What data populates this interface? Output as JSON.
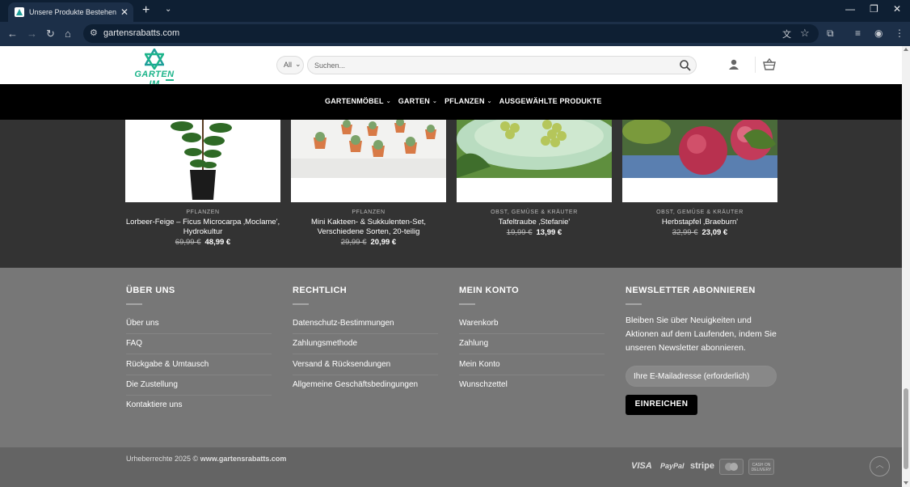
{
  "browser": {
    "tab_title": "Unsere Produkte Bestehen Aus",
    "tab_close": "✕",
    "new_tab": "+",
    "url": "gartensrabatts.com"
  },
  "header": {
    "logo_text": "GARTEN IM",
    "search_scope": "All",
    "search_placeholder": "Suchen..."
  },
  "nav": {
    "items": [
      {
        "label": "GARTENMÖBEL",
        "has_dropdown": true
      },
      {
        "label": "GARTEN",
        "has_dropdown": true
      },
      {
        "label": "PFLANZEN",
        "has_dropdown": true
      },
      {
        "label": "AUSGEWÄHLTE PRODUKTE",
        "has_dropdown": false
      }
    ]
  },
  "products": [
    {
      "category": "PFLANZEN",
      "name": "Lorbeer-Feige – Ficus Microcarpa ‚Moclame', Hydrokultur",
      "old_price": "69,99 €",
      "new_price": "48,99 €"
    },
    {
      "category": "PFLANZEN",
      "name": "Mini Kakteen- & Sukkulenten-Set, Verschiedene Sorten, 20-teilig",
      "old_price": "29,99 €",
      "new_price": "20,99 €"
    },
    {
      "category": "OBST, GEMÜSE & KRÄUTER",
      "name": "Tafeltraube ‚Stefanie'",
      "old_price": "19,99 €",
      "new_price": "13,99 €"
    },
    {
      "category": "OBST, GEMÜSE & KRÄUTER",
      "name": "Herbstapfel ‚Braeburn'",
      "old_price": "32,99 €",
      "new_price": "23,09 €"
    }
  ],
  "footer": {
    "about": {
      "heading": "ÜBER UNS",
      "links": [
        "Über uns",
        "FAQ",
        "Rückgabe & Umtausch",
        "Die Zustellung",
        "Kontaktiere uns"
      ]
    },
    "legal": {
      "heading": "RECHTLICH",
      "links": [
        "Datenschutz-Bestimmungen",
        "Zahlungsmethode",
        "Versand & Rücksendungen",
        "Allgemeine Geschäftsbedingungen"
      ]
    },
    "account": {
      "heading": "MEIN KONTO",
      "links": [
        "Warenkorb",
        "Zahlung",
        "Mein Konto",
        "Wunschzettel"
      ]
    },
    "newsletter": {
      "heading": "NEWSLETTER ABONNIEREN",
      "text": "Bleiben Sie über Neuigkeiten und Aktionen auf dem Laufenden, indem Sie unseren Newsletter abonnieren.",
      "input_placeholder": "Ihre E-Mailadresse (erforderlich)",
      "button": "EINREICHEN"
    }
  },
  "bottom": {
    "copyright_prefix": "Urheberrechte 2025 ©",
    "copyright_site": "www.gartensrabatts.com",
    "payments": [
      "VISA",
      "PayPal",
      "stripe",
      "mastercard",
      "CASH ON DELIVERY"
    ]
  },
  "colors": {
    "brand": "#1cb48a",
    "nav_bg": "#000000",
    "footer_bg": "#777777",
    "products_bg": "#333333"
  }
}
